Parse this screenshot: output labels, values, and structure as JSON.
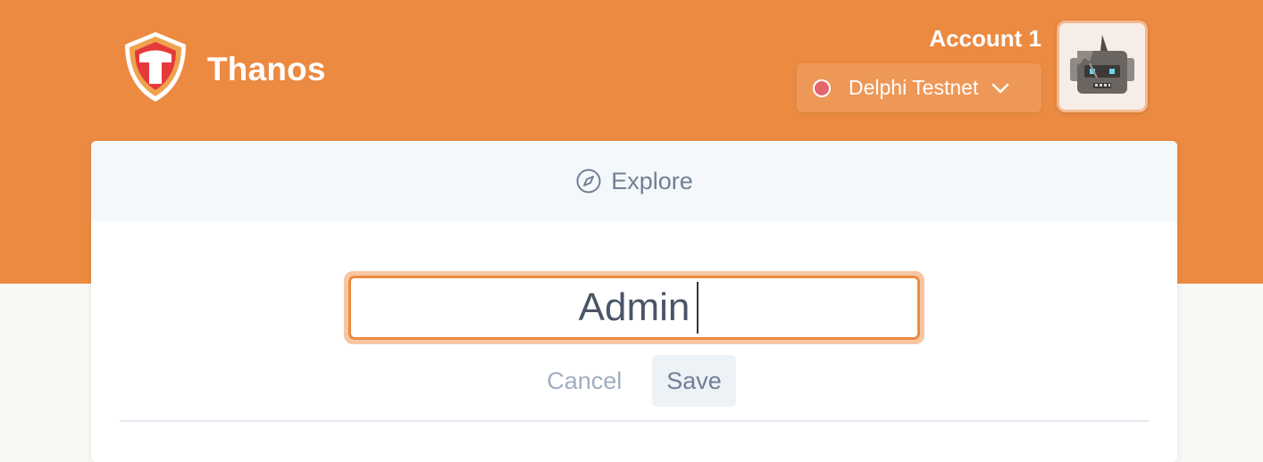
{
  "app": {
    "title": "Thanos"
  },
  "header": {
    "account_name": "Account 1",
    "network": {
      "label": "Delphi Testnet",
      "status_color": "#e5656c"
    }
  },
  "explore": {
    "label": "Explore"
  },
  "rename": {
    "value": "Admin",
    "cancel_label": "Cancel",
    "save_label": "Save"
  },
  "colors": {
    "brand": "#ec8a41",
    "focus_ring": "#f7c7a3"
  },
  "icons": {
    "logo": "thanos-shield-logo",
    "network_status": "status-dot",
    "network_chevron": "chevron-down-icon",
    "explore": "compass-icon",
    "avatar": "robot-avatar"
  }
}
